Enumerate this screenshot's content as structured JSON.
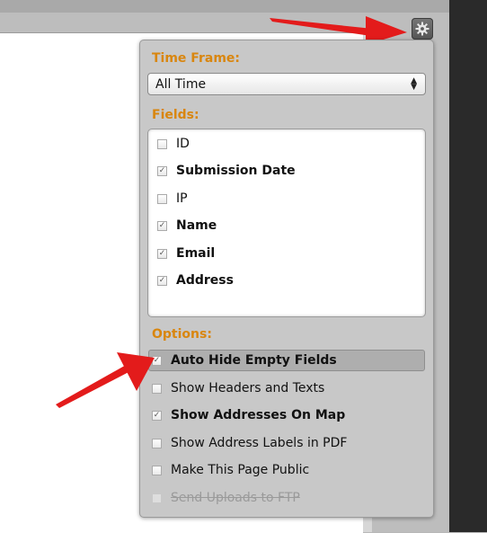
{
  "panel": {
    "time_frame_label": "Time Frame:",
    "time_frame_value": "All Time",
    "fields_label": "Fields:",
    "fields": [
      {
        "label": "ID",
        "checked": false,
        "bold": false
      },
      {
        "label": "Submission Date",
        "checked": true,
        "bold": true
      },
      {
        "label": "IP",
        "checked": false,
        "bold": false
      },
      {
        "label": "Name",
        "checked": true,
        "bold": true
      },
      {
        "label": "Email",
        "checked": true,
        "bold": true
      },
      {
        "label": "Address",
        "checked": true,
        "bold": true
      }
    ],
    "options_label": "Options:",
    "options": [
      {
        "label": "Auto Hide Empty Fields",
        "checked": true,
        "bold": true,
        "highlighted": true,
        "disabled": false
      },
      {
        "label": "Show Headers and Texts",
        "checked": false,
        "bold": false,
        "highlighted": false,
        "disabled": false
      },
      {
        "label": "Show Addresses On Map",
        "checked": true,
        "bold": true,
        "highlighted": false,
        "disabled": false
      },
      {
        "label": "Show Address Labels in PDF",
        "checked": false,
        "bold": false,
        "highlighted": false,
        "disabled": false
      },
      {
        "label": "Make This Page Public",
        "checked": false,
        "bold": false,
        "highlighted": false,
        "disabled": false
      },
      {
        "label": "Send Uploads to FTP",
        "checked": false,
        "bold": false,
        "highlighted": false,
        "disabled": true
      }
    ]
  },
  "icons": {
    "settings": "gear-icon",
    "select_caret": "updown-caret-icon",
    "check": "checkmark-icon"
  },
  "colors": {
    "section_label": "#d9860f",
    "arrow": "#e31b1b",
    "panel_bg": "#c8c8c8"
  }
}
